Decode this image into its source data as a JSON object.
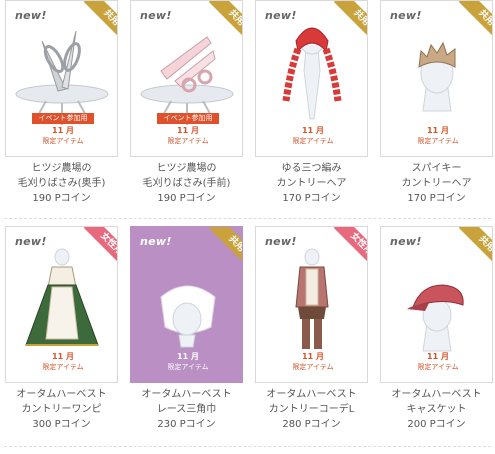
{
  "items": [
    {
      "new": "new!",
      "badge": "共用",
      "line1": "ヒツジ農場の",
      "line2": "毛刈りばさみ(奥手)",
      "price": "190 Pコイン",
      "event": "イベント参加用",
      "month": "11 月",
      "limited": "限定アイテム"
    },
    {
      "new": "new!",
      "badge": "共用",
      "line1": "ヒツジ農場の",
      "line2": "毛刈りばさみ(手前)",
      "price": "190 Pコイン",
      "event": "イベント参加用",
      "month": "11 月",
      "limited": "限定アイテム"
    },
    {
      "new": "new!",
      "badge": "共用",
      "line1": "ゆる三つ編み",
      "line2": "カントリーヘア",
      "price": "170 Pコイン",
      "month": "11 月",
      "limited": "限定アイテム"
    },
    {
      "new": "new!",
      "badge": "共用",
      "line1": "スパイキー",
      "line2": "カントリーヘア",
      "price": "170 Pコイン",
      "month": "11 月",
      "limited": "限定アイテム"
    },
    {
      "new": "new!",
      "badge": "女性用",
      "line1": "オータムハーベスト",
      "line2": "カントリーワンピ",
      "price": "300 Pコイン",
      "month": "11 月",
      "limited": "限定アイテム"
    },
    {
      "new": "new!",
      "badge": "共用",
      "line1": "オータムハーベスト",
      "line2": "レース三角巾",
      "price": "230 Pコイン",
      "month": "11 月",
      "limited": "限定アイテム"
    },
    {
      "new": "new!",
      "badge": "女性用",
      "line1": "オータムハーベスト",
      "line2": "カントリーコーデL",
      "price": "280 Pコイン",
      "month": "11 月",
      "limited": "限定アイテム"
    },
    {
      "new": "new!",
      "badge": "共用",
      "line1": "オータムハーベスト",
      "line2": "キャスケット",
      "price": "200 Pコイン",
      "month": "11 月",
      "limited": "限定アイテム"
    }
  ],
  "colors": {
    "gold_badge": "#c9a23b",
    "pink_badge": "#e8687d",
    "purple_bg": "#b98fc4"
  }
}
